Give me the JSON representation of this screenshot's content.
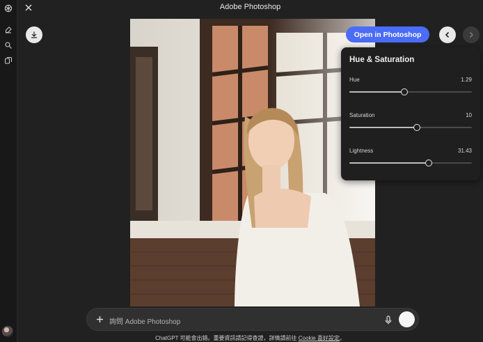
{
  "window": {
    "title": "Adobe Photoshop"
  },
  "rail": {
    "icons": [
      "chatgpt-logo-icon",
      "new-chat-icon",
      "search-icon",
      "library-icon"
    ]
  },
  "toolbar": {
    "open_button": "Open in Photoshop"
  },
  "panel": {
    "title": "Hue & Saturation",
    "sliders": [
      {
        "label": "Hue",
        "value": "1.29",
        "level": 0.45
      },
      {
        "label": "Saturation",
        "value": "10",
        "level": 0.55
      },
      {
        "label": "Lightness",
        "value": "31.43",
        "level": 0.65
      }
    ]
  },
  "composer": {
    "placeholder": "詢問 Adobe Photoshop"
  },
  "footer": {
    "text": "ChatGPT 可能會出錯。重要資訊請記得查證，詳情請前往 ",
    "link": "Cookie 喜好設定",
    "suffix": "。"
  },
  "colors": {
    "accent": "#4a6cf7",
    "panel_bg": "#1f1f1f",
    "app_bg": "#212121"
  }
}
